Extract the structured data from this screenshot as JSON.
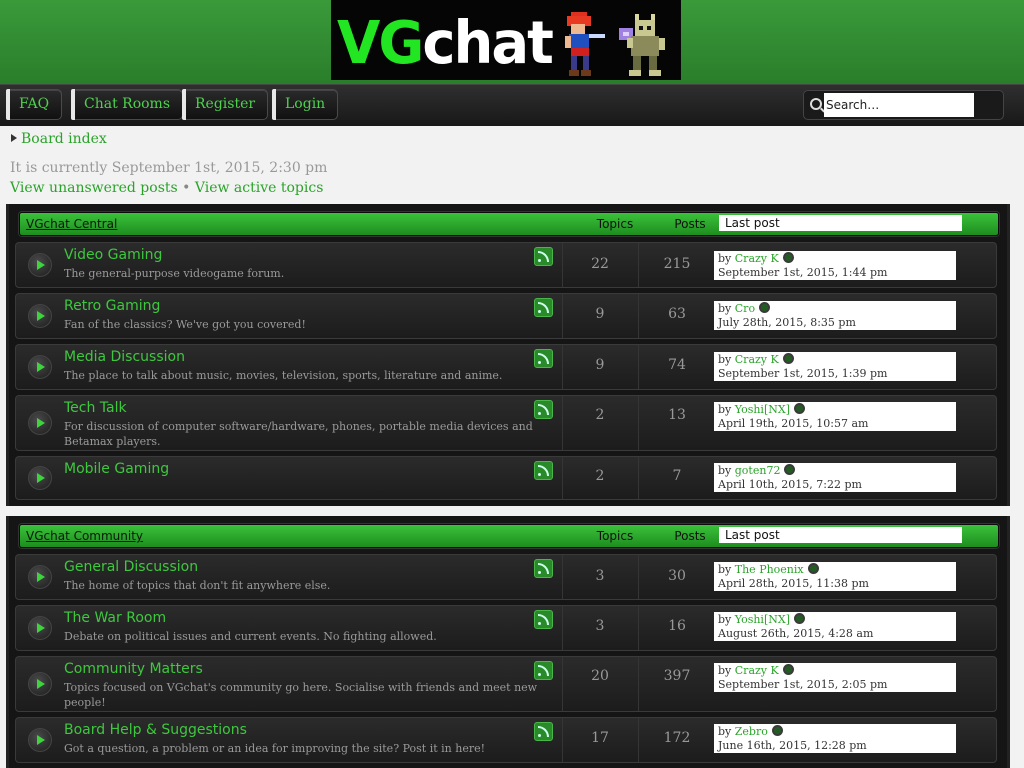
{
  "logo": {
    "prefix": "VG",
    "suffix": "chat"
  },
  "nav": {
    "buttons": [
      "FAQ",
      "Chat Rooms",
      "Register",
      "Login"
    ],
    "search_placeholder": "Search…"
  },
  "breadcrumb": {
    "label": "Board index"
  },
  "info": {
    "current_time": "It is currently September 1st, 2015, 2:30 pm",
    "unanswered": "View unanswered posts",
    "separator": "•",
    "active": "View active topics"
  },
  "columns": {
    "topics": "Topics",
    "posts": "Posts",
    "last_post": "Last post"
  },
  "categories": [
    {
      "title": "VGchat Central",
      "forums": [
        {
          "name": "Video Gaming",
          "desc": "The general-purpose videogame forum.",
          "topics": "22",
          "posts": "215",
          "by": "by",
          "user": "Crazy K",
          "date": "September 1st, 2015, 1:44 pm"
        },
        {
          "name": "Retro Gaming",
          "desc": "Fan of the classics? We've got you covered!",
          "topics": "9",
          "posts": "63",
          "by": "by",
          "user": "Cro",
          "date": "July 28th, 2015, 8:35 pm"
        },
        {
          "name": "Media Discussion",
          "desc": "The place to talk about music, movies, television, sports, literature and anime.",
          "topics": "9",
          "posts": "74",
          "by": "by",
          "user": "Crazy K",
          "date": "September 1st, 2015, 1:39 pm"
        },
        {
          "name": "Tech Talk",
          "desc": "For discussion of computer software/hardware, phones, portable media devices and Betamax players.",
          "topics": "2",
          "posts": "13",
          "by": "by",
          "user": "Yoshi[NX]",
          "date": "April 19th, 2015, 10:57 am"
        },
        {
          "name": "Mobile Gaming",
          "desc": "",
          "topics": "2",
          "posts": "7",
          "by": "by",
          "user": "goten72",
          "date": "April 10th, 2015, 7:22 pm"
        }
      ]
    },
    {
      "title": "VGchat Community",
      "forums": [
        {
          "name": "General Discussion",
          "desc": "The home of topics that don't fit anywhere else.",
          "topics": "3",
          "posts": "30",
          "by": "by",
          "user": "The Phoenix",
          "date": "April 28th, 2015, 11:38 pm"
        },
        {
          "name": "The War Room",
          "desc": "Debate on political issues and current events. No fighting allowed.",
          "topics": "3",
          "posts": "16",
          "by": "by",
          "user": "Yoshi[NX]",
          "date": "August 26th, 2015, 4:28 am"
        },
        {
          "name": "Community Matters",
          "desc": "Topics focused on VGchat's community go here. Socialise with friends and meet new people!",
          "topics": "20",
          "posts": "397",
          "by": "by",
          "user": "Crazy K",
          "date": "September 1st, 2015, 2:05 pm"
        },
        {
          "name": "Board Help & Suggestions",
          "desc": "Got a question, a problem or an idea for improving the site? Post it in here!",
          "topics": "17",
          "posts": "172",
          "by": "by",
          "user": "Zebro",
          "date": "June 16th, 2015, 12:28 pm"
        }
      ]
    }
  ],
  "icons": {
    "forum": "forum-read-icon",
    "feed": "rss-feed-icon",
    "last_post": "view-latest-post-icon",
    "search": "search-icon"
  },
  "colors": {
    "accent_green": "#3ec83e",
    "link_green": "#2aa32a",
    "header_green": "#2a8a2a"
  }
}
